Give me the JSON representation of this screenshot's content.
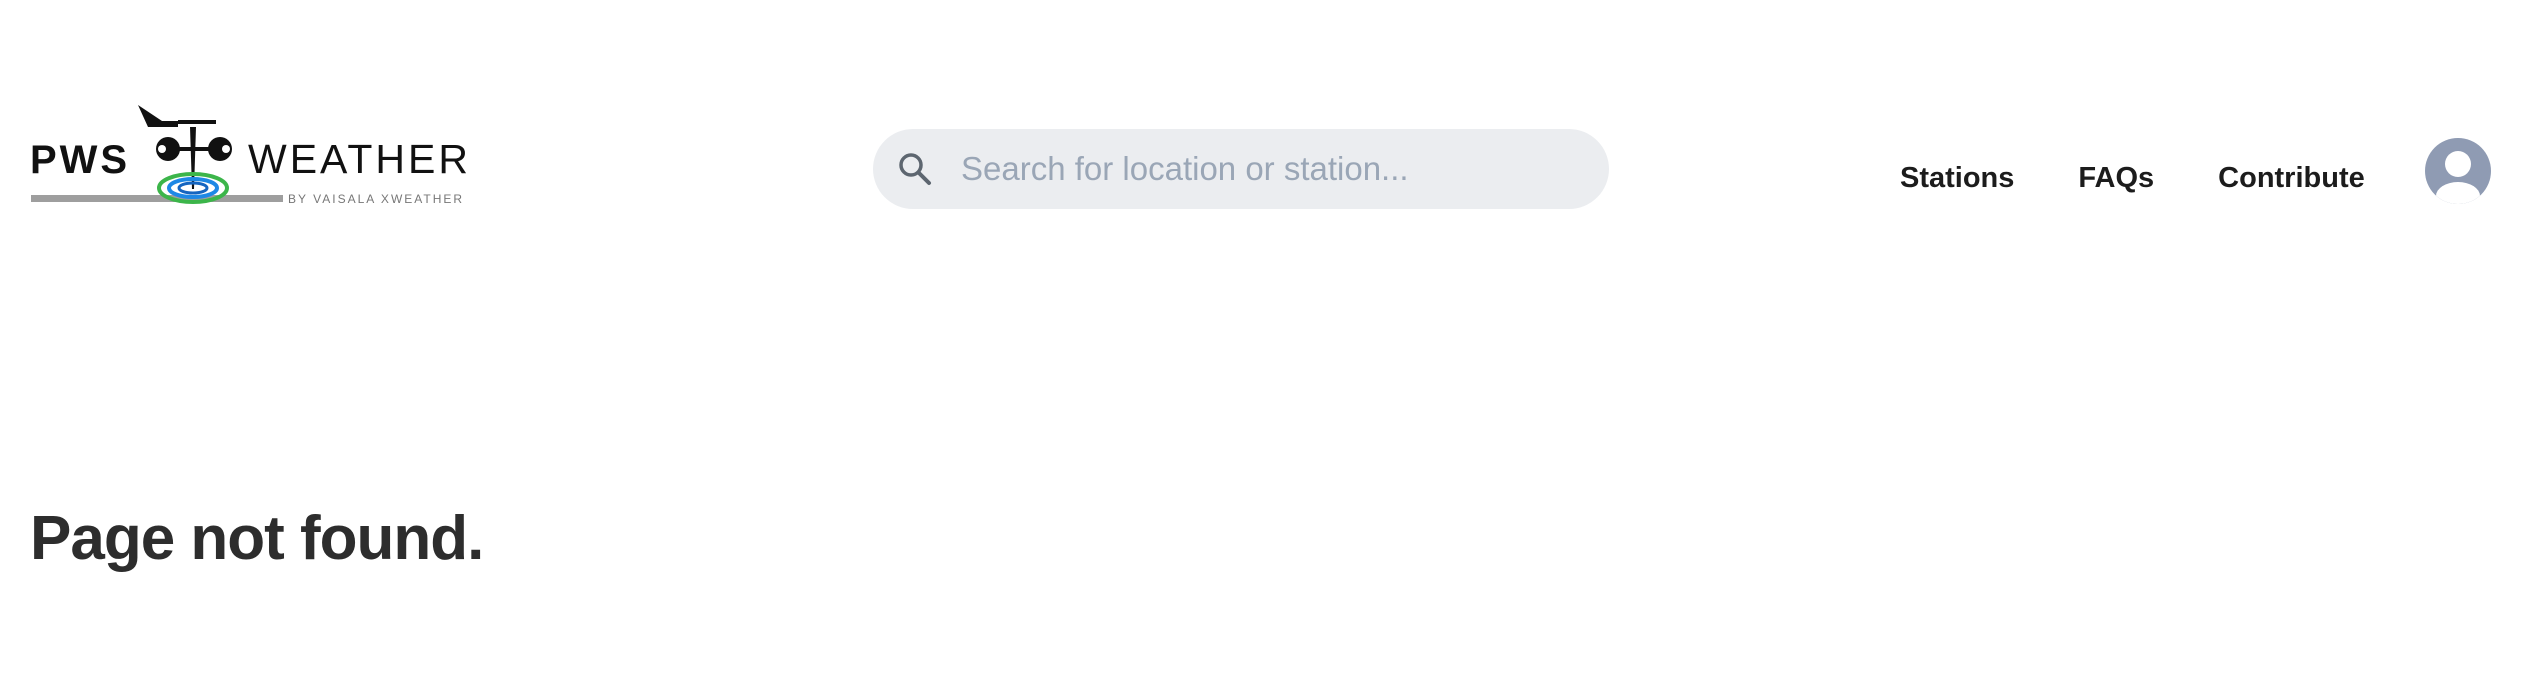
{
  "logo": {
    "text_left": "PWS",
    "text_right": "WEATHER",
    "tagline": "BY VAISALA XWEATHER",
    "icon": "weather-station-icon"
  },
  "search": {
    "placeholder": "Search for location or station...",
    "value": "",
    "icon": "search-icon"
  },
  "nav": {
    "items": [
      {
        "label": "Stations"
      },
      {
        "label": "FAQs"
      },
      {
        "label": "Contribute"
      }
    ]
  },
  "user": {
    "icon": "user-avatar-icon"
  },
  "main": {
    "title": "Page not found."
  },
  "colors": {
    "search_bg": "#ebedf0",
    "placeholder": "#9aa6b6",
    "avatar": "#8f9bb3",
    "title": "#2d2d2d",
    "logo_gray": "#9e9e9e",
    "logo_green": "#3cb54a",
    "logo_blue": "#1e88e5"
  }
}
